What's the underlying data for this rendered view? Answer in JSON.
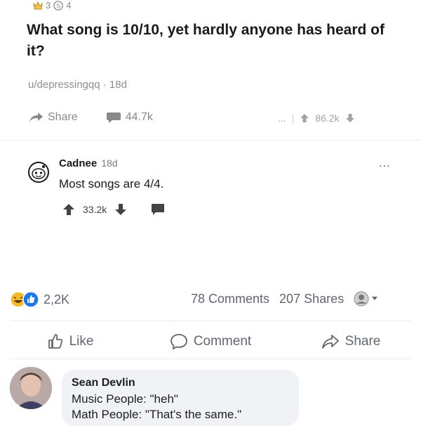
{
  "post": {
    "award_count_1": "3",
    "award_count_2": "4",
    "title": "What song is 10/10, yet hardly anyone has heard of it?",
    "author": "u/depressingqq",
    "age": "18d",
    "share_label": "Share",
    "comments_count": "44.7k",
    "more": "...",
    "upvotes": "86.2k"
  },
  "comment": {
    "username": "Cadnee",
    "age": "18d",
    "text": "Most songs are 4/4.",
    "score": "33.2k",
    "more": "..."
  },
  "facebook": {
    "reactions_count": "2,2K",
    "comments": "78 Comments",
    "shares": "207 Shares",
    "like_label": "Like",
    "comment_label": "Comment",
    "share_label": "Share",
    "colors": {
      "like_blue": "#1877f2",
      "haha_yellow": "#f7b928",
      "text_gray": "#606770",
      "bubble_bg": "#f0f2f5"
    }
  },
  "reply": {
    "name": "Sean Devlin",
    "line1": "Music People: \"heh\"",
    "line2": "Math People: \"That's the same.\""
  }
}
